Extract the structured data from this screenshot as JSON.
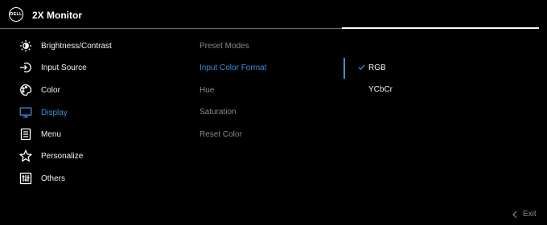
{
  "header": {
    "logo_text": "DELL",
    "title": "2X Monitor"
  },
  "menu": [
    {
      "label": "Brightness/Contrast",
      "icon": "brightness-icon"
    },
    {
      "label": "Input Source",
      "icon": "input-source-icon"
    },
    {
      "label": "Color",
      "icon": "color-palette-icon"
    },
    {
      "label": "Display",
      "icon": "display-icon",
      "active": true
    },
    {
      "label": "Menu",
      "icon": "menu-icon"
    },
    {
      "label": "Personalize",
      "icon": "star-icon"
    },
    {
      "label": "Others",
      "icon": "others-icon"
    }
  ],
  "submenu": [
    {
      "label": "Preset Modes"
    },
    {
      "label": "Input Color Format",
      "active": true
    },
    {
      "label": "Hue"
    },
    {
      "label": "Saturation"
    },
    {
      "label": "Reset Color"
    }
  ],
  "options": [
    {
      "label": "RGB",
      "selected": true
    },
    {
      "label": "YCbCr",
      "selected": false
    }
  ],
  "footer": {
    "exit_label": "Exit"
  },
  "colors": {
    "accent": "#3d8fd6",
    "background": "#000000",
    "muted_text": "#8a8a8a"
  }
}
